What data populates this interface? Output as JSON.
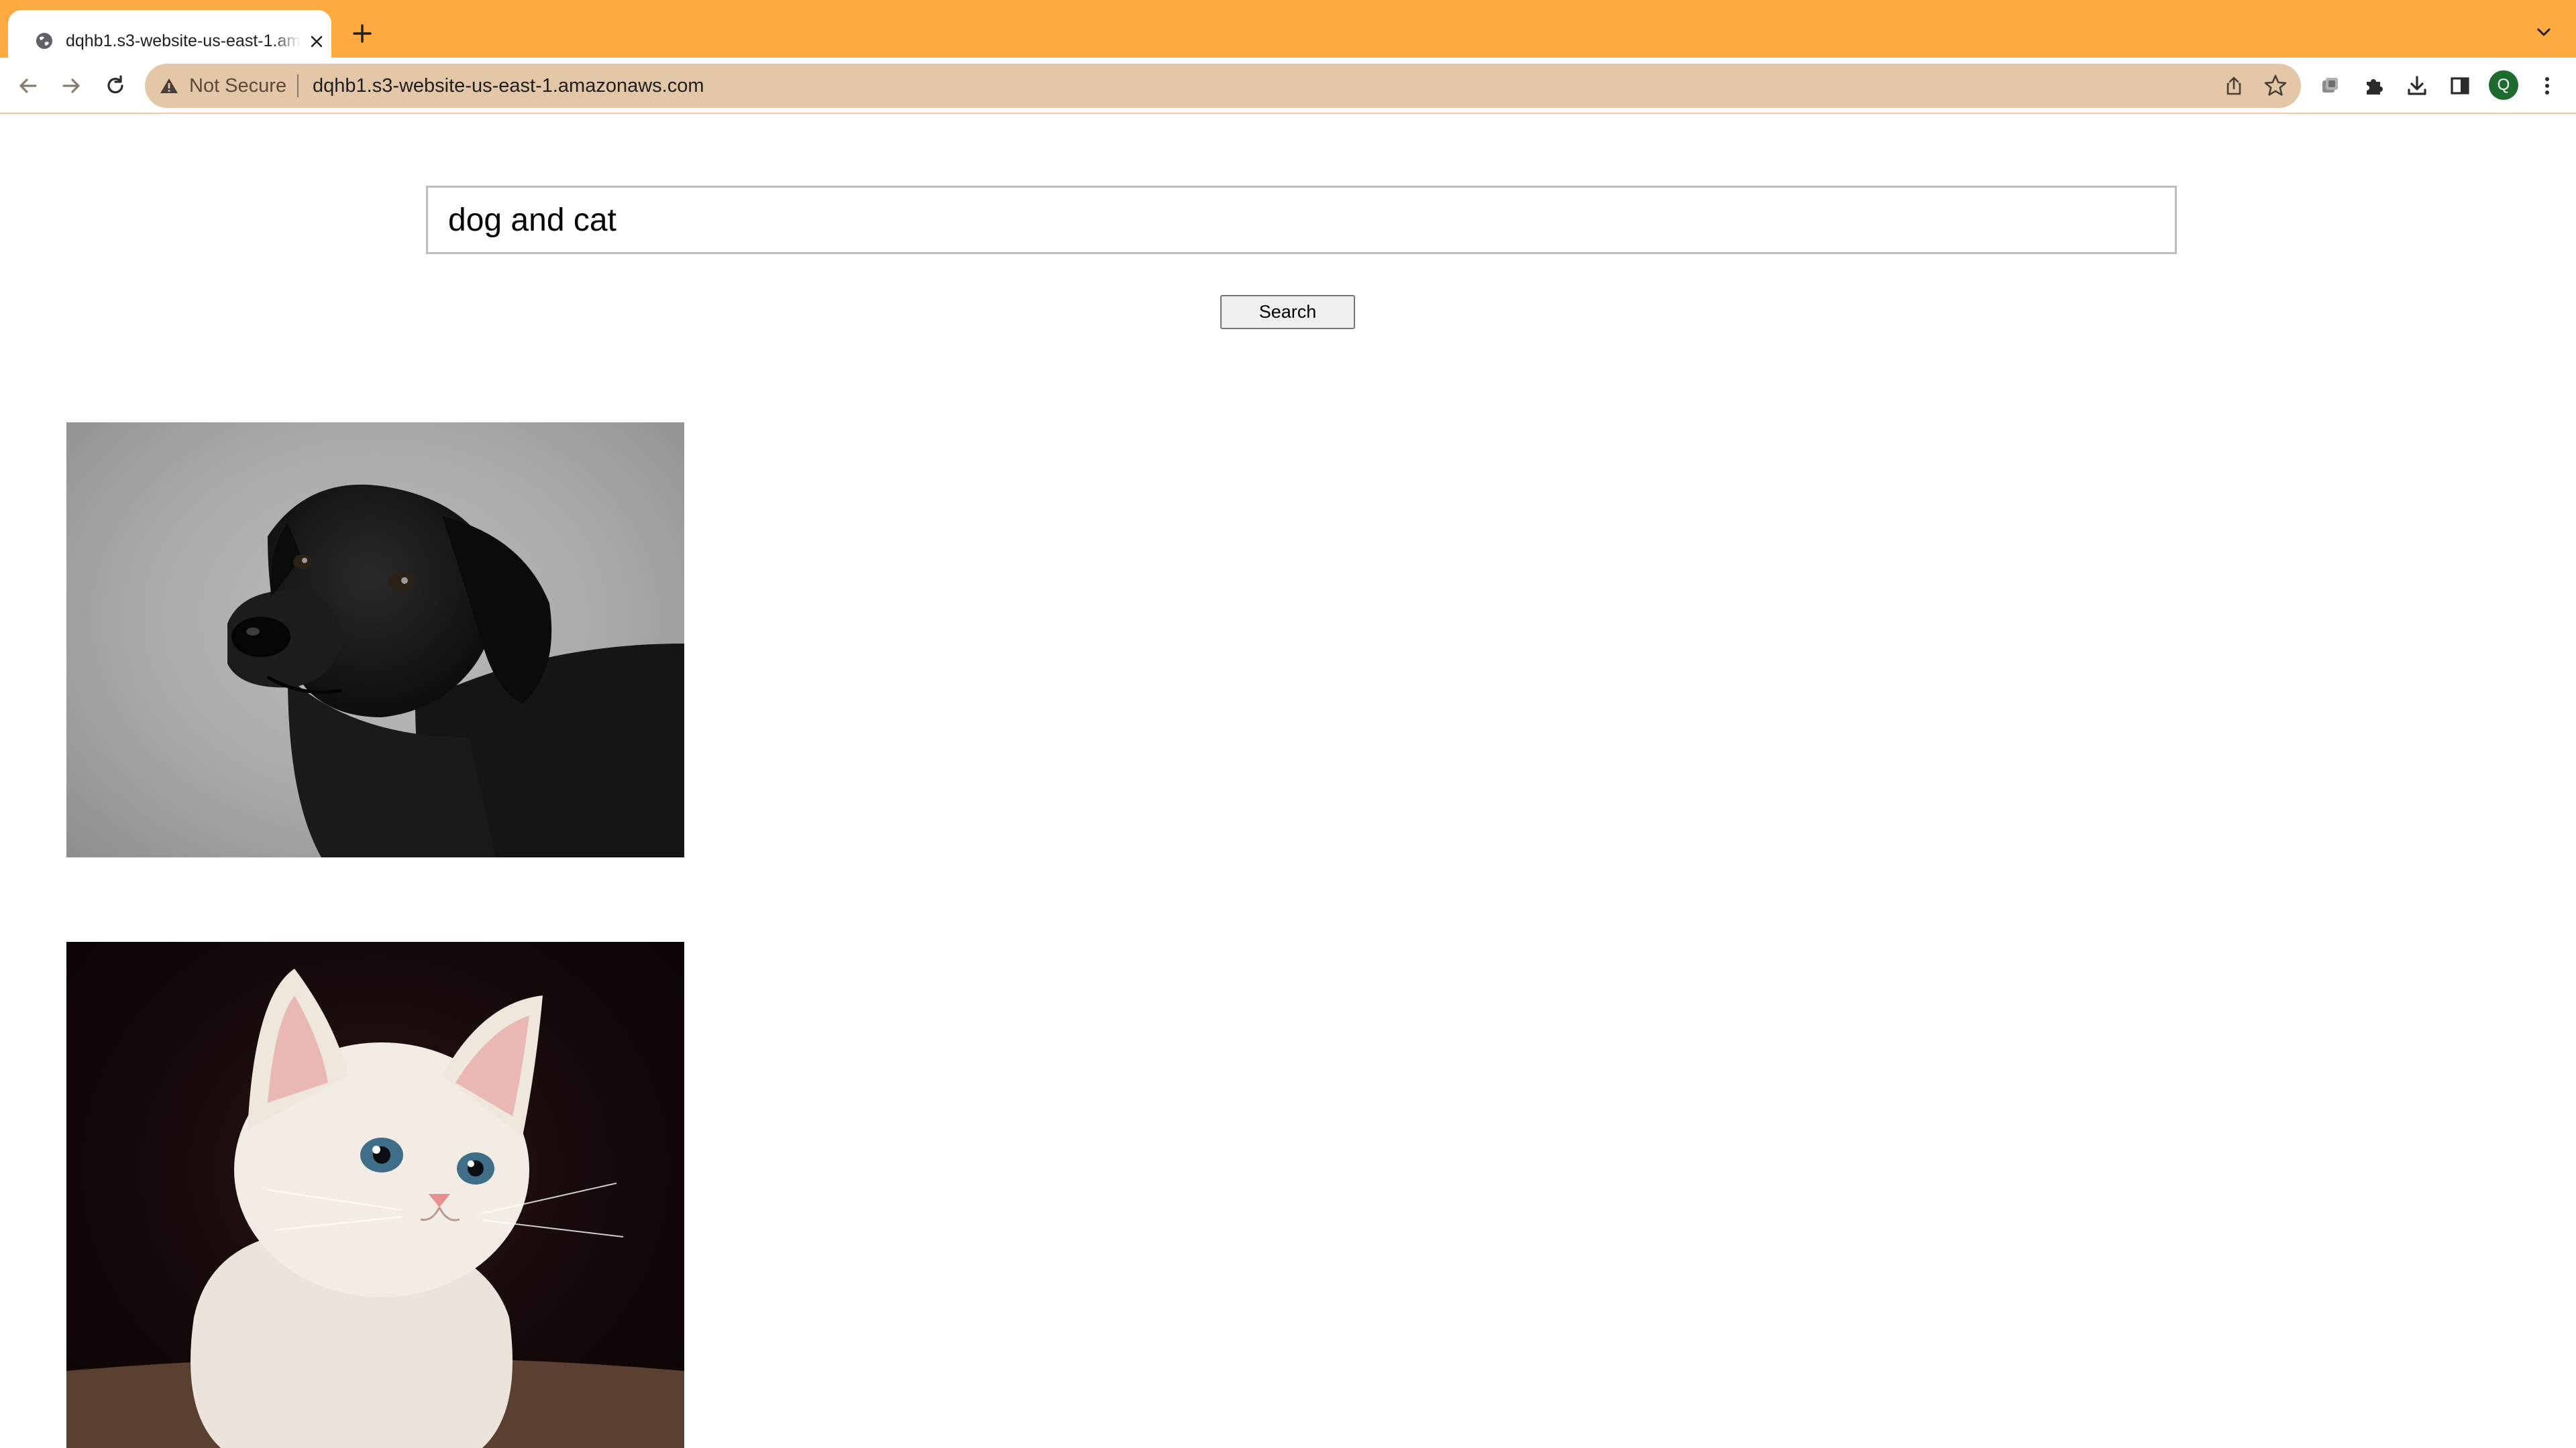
{
  "browser": {
    "tab": {
      "title": "dqhb1.s3-website-us-east-1.amazonaws.com",
      "favicon": "globe-icon",
      "close_icon": "close-icon"
    },
    "new_tab_icon": "plus-icon",
    "tab_menu_icon": "chevron-down-icon",
    "colors": {
      "frame": "#FEAA40",
      "omnibox": "#E3C7A7",
      "avatar": "#1E6B2E"
    }
  },
  "toolbar": {
    "back_icon": "arrow-left-icon",
    "forward_icon": "arrow-right-icon",
    "reload_icon": "reload-icon",
    "security_icon": "warning-triangle-icon",
    "security_label": "Not Secure",
    "url": "dqhb1.s3-website-us-east-1.amazonaws.com",
    "share_icon": "share-icon",
    "bookmark_icon": "star-icon",
    "extensions": [
      "tab-search-icon",
      "puzzle-icon",
      "download-icon",
      "side-panel-icon"
    ],
    "profile_initial": "Q",
    "menu_icon": "more-vert-icon"
  },
  "search": {
    "query": "dog and cat",
    "button_label": "Search"
  },
  "results": [
    {
      "subject": "dog",
      "alt": "dog"
    },
    {
      "subject": "cat",
      "alt": "cat"
    }
  ]
}
